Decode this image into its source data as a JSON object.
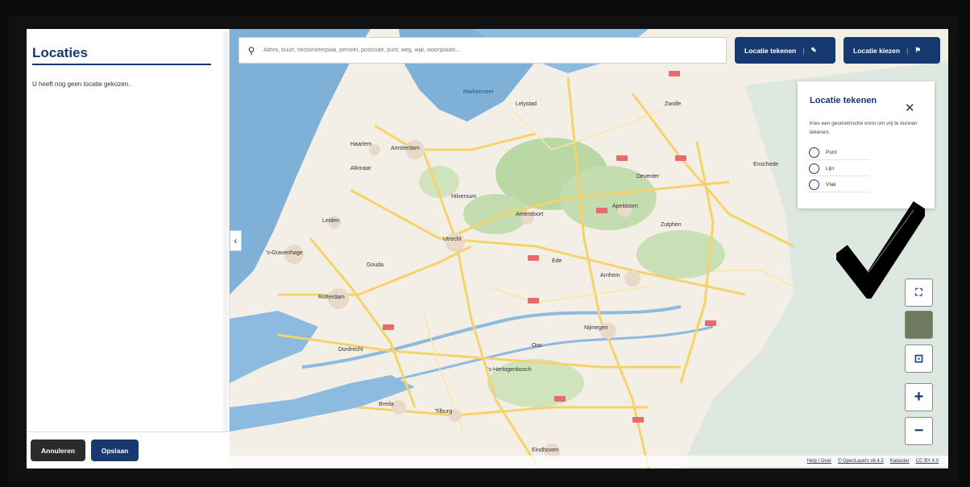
{
  "sidebar": {
    "title": "Locaties",
    "empty_text": "U heeft nog geen locatie gekozen.",
    "cancel_label": "Annuleren",
    "save_label": "Opslaan"
  },
  "search": {
    "placeholder": "Adres, buurt, hectometerpaal, perceel, postcode, punt, weg, wijk, woonplaats..."
  },
  "toolbar": {
    "draw_label": "Locatie tekenen",
    "choose_label": "Locatie kiezen"
  },
  "draw_panel": {
    "title": "Locatie tekenen",
    "description": "Kies een geometrische vorm om vrij te kunnen tekenen.",
    "options": [
      "Punt",
      "Lijn",
      "Vlak"
    ]
  },
  "map": {
    "places": [
      "Amsterdam",
      "Haarlem",
      "Leiden",
      "'s-Gravenhage",
      "Rotterdam",
      "Utrecht",
      "Amersfoort",
      "Apeldoorn",
      "Arnhem",
      "Nijmegen",
      "Eindhoven",
      "Tilburg",
      "Breda",
      "Lelystad",
      "Zwolle",
      "Deventer",
      "Hilversum",
      "Gouda",
      "Dordrecht",
      "'s-Hertogenbosch",
      "Ede",
      "Zutphen",
      "Oss",
      "Enschede",
      "Alkmaar"
    ],
    "water_label": "Markermeer"
  },
  "attribution": {
    "help": "Help / Over",
    "openlayers": "© OpenLayers v6.4.3",
    "kadaster": "Kadaster",
    "license": "CC BY 4.0"
  },
  "icons": {
    "search": "search-icon",
    "edit": "edit-icon",
    "map": "map-icon",
    "close": "close-icon",
    "fullscreen": "fullscreen-icon",
    "center": "center-icon",
    "zoom_in": "plus-icon",
    "zoom_out": "minus-icon"
  },
  "colors": {
    "brand": "#163a70",
    "sea": "#7fb0d8",
    "land": "#f3efe6",
    "forest": "#b9d8a4",
    "road": "#f5d36a"
  }
}
